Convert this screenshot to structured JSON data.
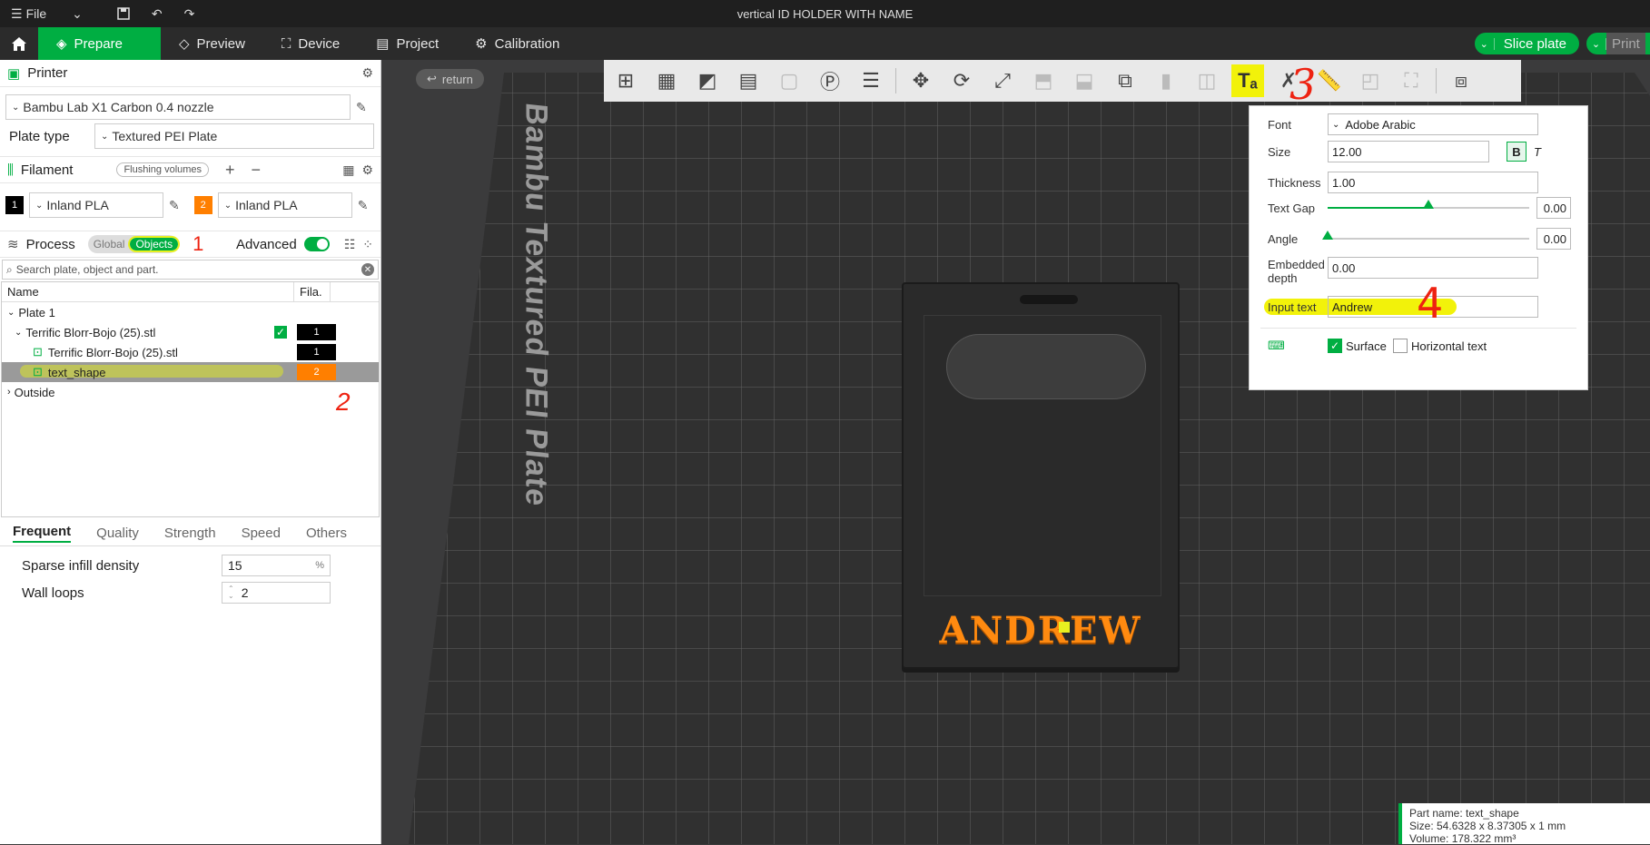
{
  "window": {
    "title": "vertical ID HOLDER WITH NAME",
    "file_menu": "File"
  },
  "tabs": [
    {
      "label": "Prepare"
    },
    {
      "label": "Preview"
    },
    {
      "label": "Device"
    },
    {
      "label": "Project"
    },
    {
      "label": "Calibration"
    }
  ],
  "actions": {
    "slice": "Slice plate",
    "print": "Print"
  },
  "printer": {
    "section": "Printer",
    "name": "Bambu Lab X1 Carbon 0.4 nozzle",
    "plate_label": "Plate type",
    "plate_value": "Textured PEI Plate"
  },
  "filament": {
    "section": "Filament",
    "flushing": "Flushing volumes",
    "slots": [
      {
        "num": "1",
        "name": "Inland PLA",
        "color": "#000000"
      },
      {
        "num": "2",
        "name": "Inland PLA",
        "color": "#ff7f00"
      }
    ]
  },
  "process": {
    "section": "Process",
    "global": "Global",
    "objects": "Objects",
    "advanced": "Advanced",
    "search_placeholder": "Search plate, object and part."
  },
  "tree": {
    "col_name": "Name",
    "col_fila": "Fila.",
    "plate": "Plate 1",
    "object": "Terrific Blorr-Bojo (25).stl",
    "object_fila": "1",
    "part": "Terrific Blorr-Bojo (25).stl",
    "part_fila": "1",
    "text_part": "text_shape",
    "text_fila": "2",
    "outside": "Outside"
  },
  "settings_tabs": [
    "Frequent",
    "Quality",
    "Strength",
    "Speed",
    "Others"
  ],
  "params": {
    "infill_label": "Sparse infill density",
    "infill_value": "15",
    "infill_unit": "%",
    "walls_label": "Wall loops",
    "walls_value": "2"
  },
  "viewport": {
    "return": "return",
    "plate_label": "Bambu Textured PEI Plate",
    "model_text": "ANDREW"
  },
  "text_tool": {
    "font_label": "Font",
    "font_value": "Adobe Arabic",
    "size_label": "Size",
    "size_value": "12.00",
    "bold": "B",
    "italic": "T",
    "thickness_label": "Thickness",
    "thickness_value": "1.00",
    "gap_label": "Text Gap",
    "gap_value": "0.00",
    "gap_level": 0.5,
    "angle_label": "Angle",
    "angle_value": "0.00",
    "angle_level": 0.0,
    "embedded_label": "Embedded depth",
    "embedded_value": "0.00",
    "input_label": "Input text",
    "input_value": "Andrew",
    "surface": "Surface",
    "horizontal": "Horizontal text"
  },
  "status": {
    "part_name": "Part name: text_shape",
    "size": "Size: 54.6328 x 8.37305 x 1 mm",
    "volume": "Volume: 178.322 mm³"
  },
  "annotations": [
    "1",
    "2",
    "3",
    "4"
  ]
}
